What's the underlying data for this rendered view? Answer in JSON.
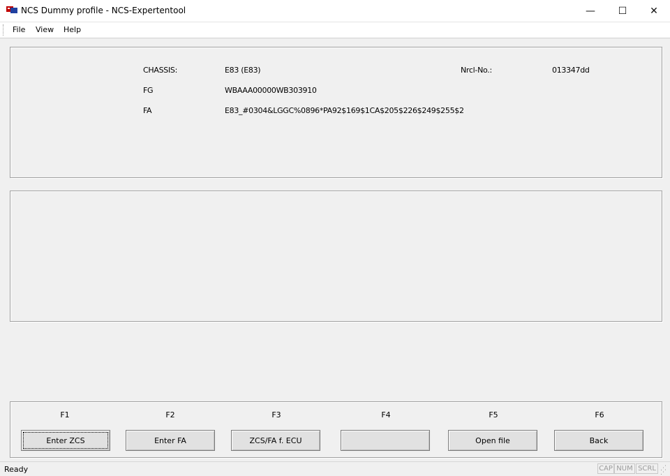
{
  "window": {
    "title": "NCS Dummy profile - NCS-Expertentool",
    "controls": {
      "minimize": "—",
      "maximize": "☐",
      "close": "✕"
    }
  },
  "menu": {
    "file": "File",
    "view": "View",
    "help": "Help"
  },
  "info": {
    "chassis_label": "CHASSIS:",
    "chassis_value": "E83 (E83)",
    "nrcl_label": "Nrcl-No.:",
    "nrcl_value": "013347dd",
    "fg_label": "FG",
    "fg_value": "WBAAA00000WB303910",
    "fa_label": "FA",
    "fa_value": "E83_#0304&LGGC%0896*PA92$169$1CA$205$226$249$255$2"
  },
  "function_keys": [
    {
      "key": "F1",
      "label": "Enter ZCS"
    },
    {
      "key": "F2",
      "label": "Enter FA"
    },
    {
      "key": "F3",
      "label": "ZCS/FA f. ECU"
    },
    {
      "key": "F4",
      "label": ""
    },
    {
      "key": "F5",
      "label": "Open file"
    },
    {
      "key": "F6",
      "label": "Back"
    }
  ],
  "status": {
    "text": "Ready",
    "indicators": {
      "cap": "CAP",
      "num": "NUM",
      "scrl": "SCRL"
    }
  },
  "icons": {
    "app": "app-icon",
    "grip": "size-grip-icon"
  }
}
